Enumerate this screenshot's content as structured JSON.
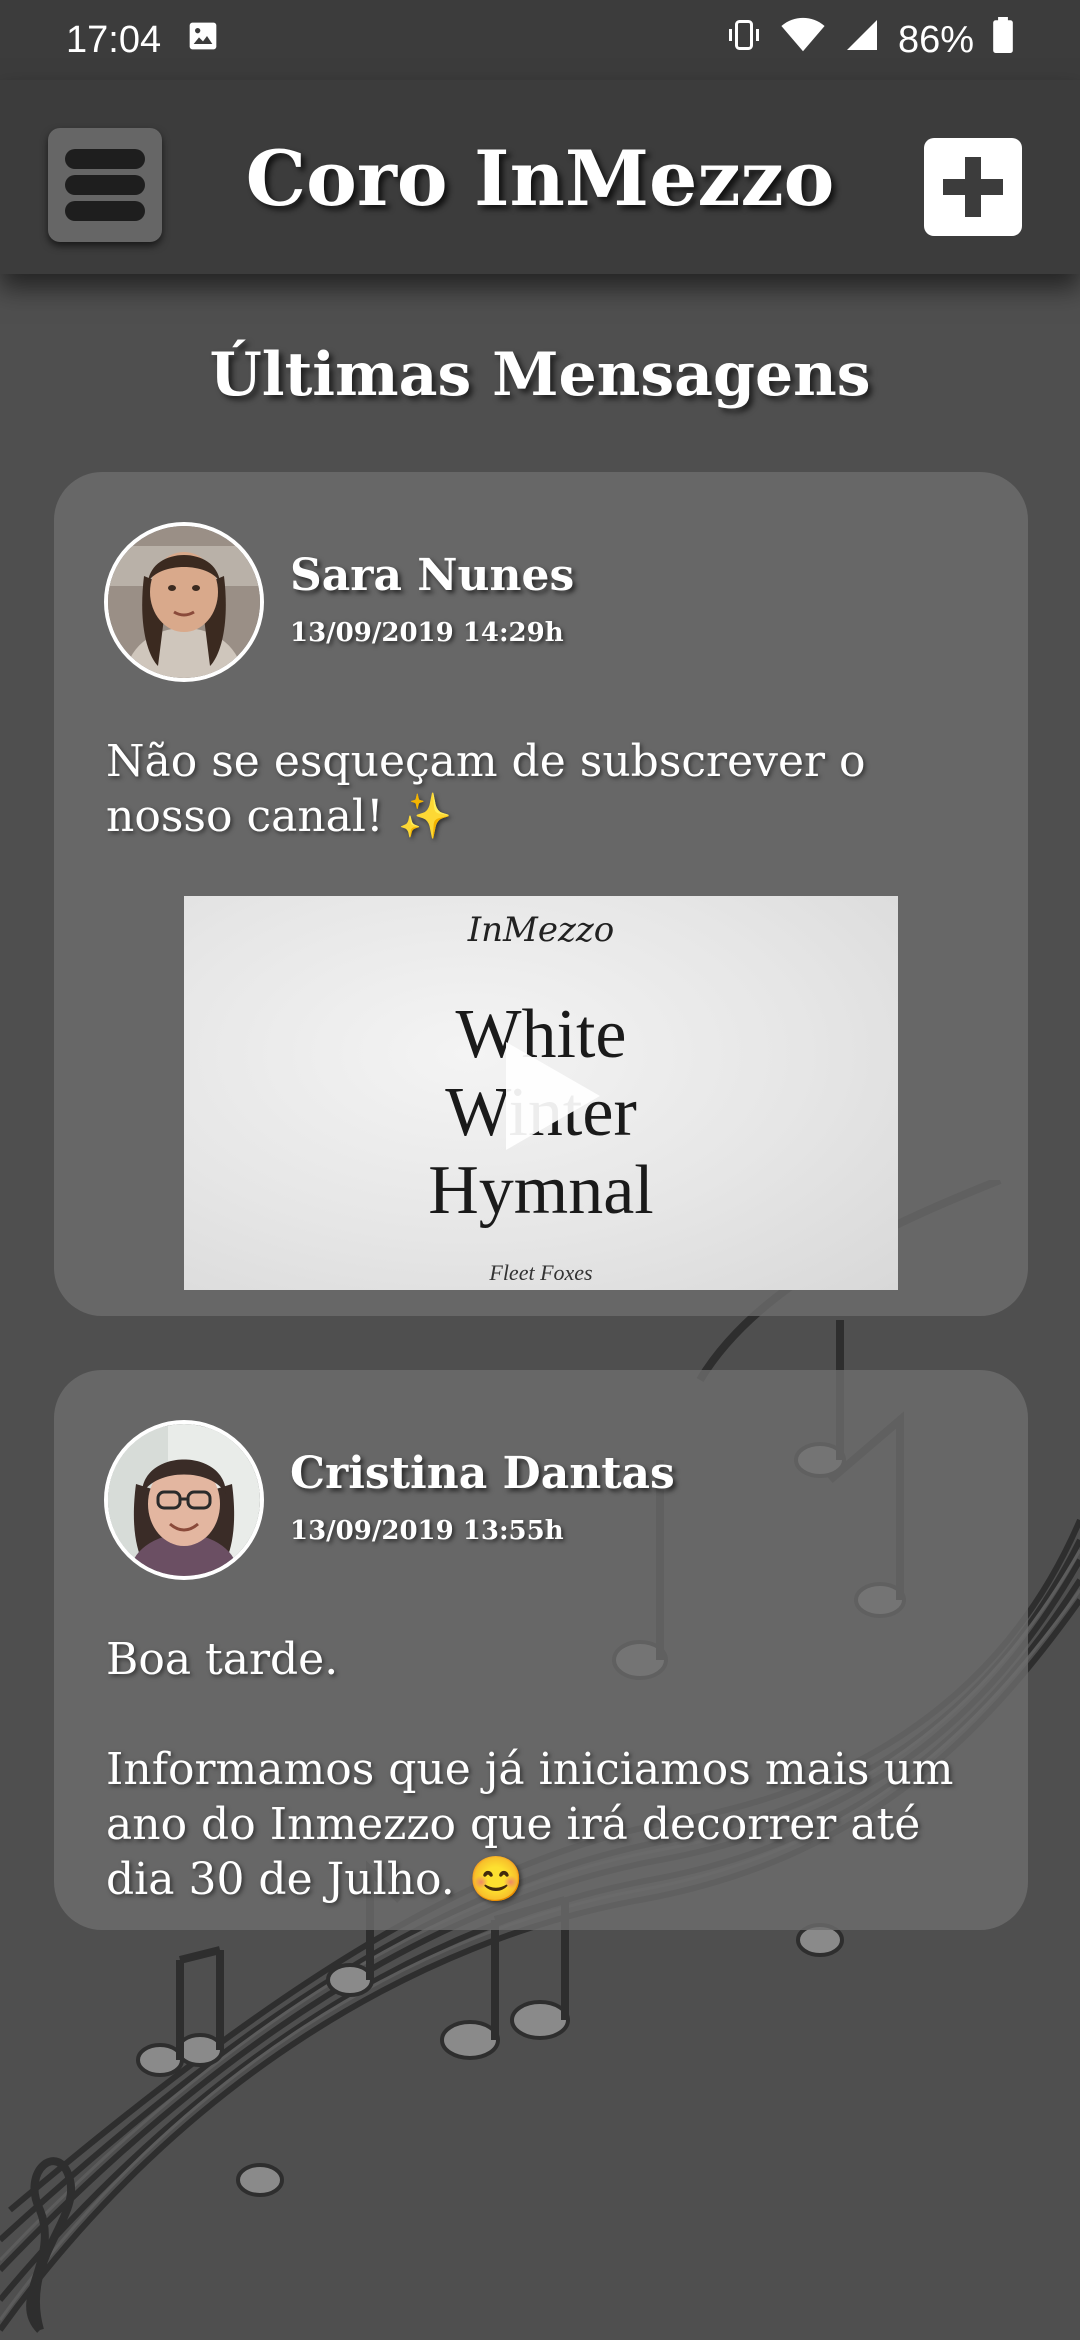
{
  "status_bar": {
    "time": "17:04",
    "battery": "86%",
    "icons": [
      "image-icon",
      "vibrate-icon",
      "wifi-icon",
      "signal-icon",
      "battery-icon"
    ]
  },
  "app_bar": {
    "title": "Coro InMezzo",
    "menu_icon": "menu-icon",
    "add_icon": "plus-icon"
  },
  "page": {
    "heading": "Últimas Mensagens"
  },
  "messages": [
    {
      "author": "Sara Nunes",
      "timestamp": "13/09/2019 14:29h",
      "text": "Não se esqueçam de subscrever o nosso canal! ✨",
      "video": {
        "brand": "InMezzo",
        "title": "White\nWinter\nHymnal",
        "artist": "Fleet Foxes"
      }
    },
    {
      "author": "Cristina Dantas",
      "timestamp": "13/09/2019 13:55h",
      "text": "Boa tarde.\n\nInformamos que já iniciamos mais um ano do Inmezzo que irá decorrer até dia 30 de Julho. 😊"
    }
  ],
  "colors": {
    "background": "#4f4f4f",
    "bar": "#3c3c3c",
    "card": "#6e6e6e"
  }
}
